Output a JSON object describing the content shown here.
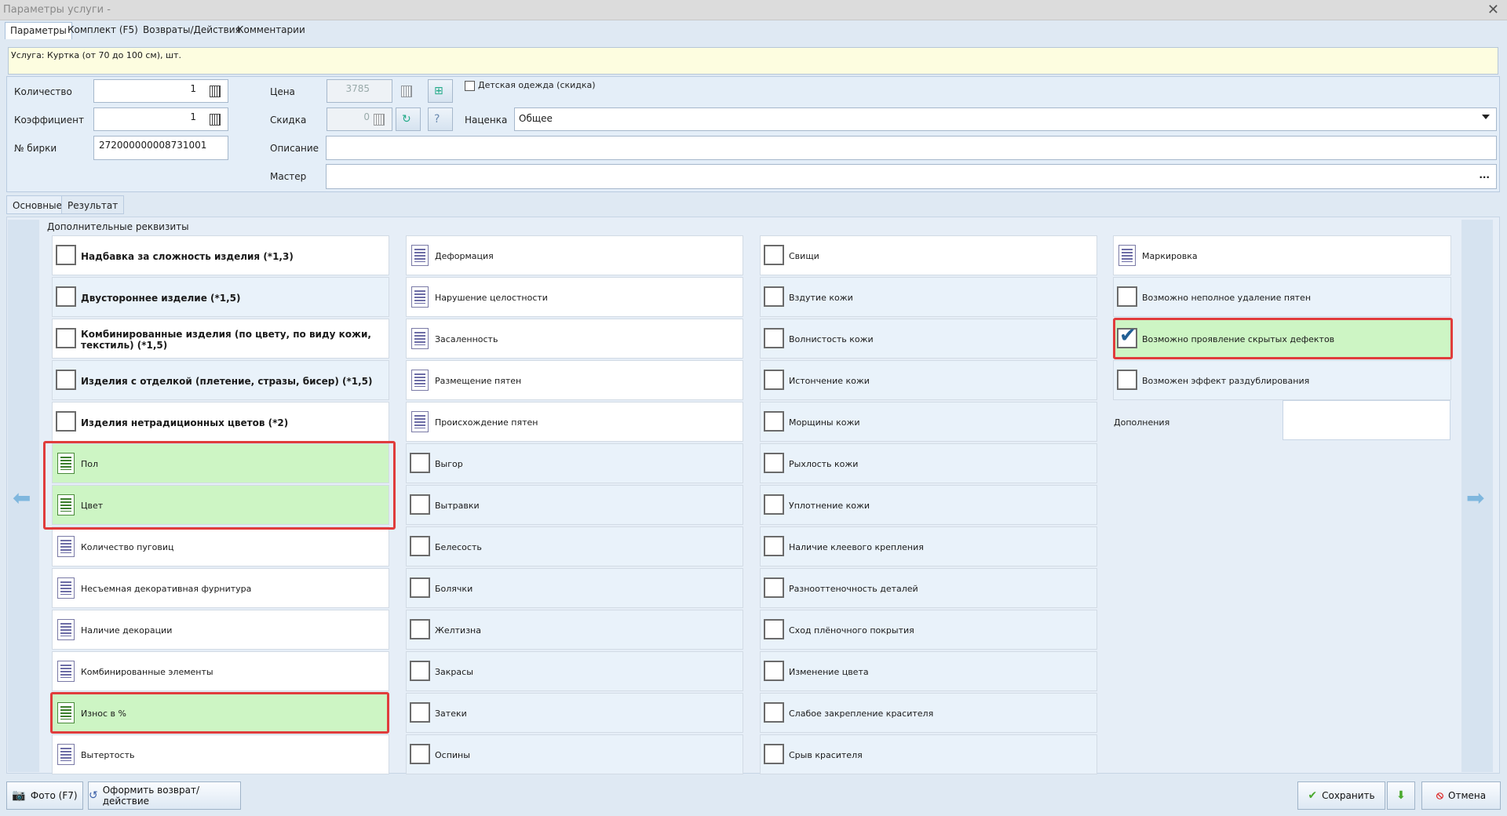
{
  "window": {
    "title": "Параметры услуги -"
  },
  "tabs_top": [
    "Параметры",
    "Комплект (F5)",
    "Возвраты/Действия",
    "Комментарии"
  ],
  "service": "Услуга: Куртка (от 70 до 100 см), шт.",
  "fields": {
    "quantity_label": "Количество",
    "quantity_value": "1",
    "coef_label": "Коэффициент",
    "coef_value": "1",
    "tag_label": "№ бирки",
    "tag_value": "272000000008731001",
    "price_label": "Цена",
    "price_value": "3785",
    "discount_label": "Скидка",
    "discount_value": "0",
    "kids_label": "Детская одежда (скидка)",
    "markup_label": "Наценка",
    "markup_value": "Общее",
    "desc_label": "Описание",
    "master_label": "Мастер",
    "master_dots": "..."
  },
  "tabs_mid": [
    "Основные",
    "Результат"
  ],
  "section_title": "Дополнительные реквизиты",
  "col1": [
    {
      "label": "Надбавка за сложность изделия (*1,3)",
      "kind": "check",
      "bold": true,
      "bg": "white"
    },
    {
      "label": "Двустороннее изделие (*1,5)",
      "kind": "check",
      "bold": true,
      "bg": "blue"
    },
    {
      "label": "Комбинированные изделия (по цвету, по виду кожи, текстиль) (*1,5)",
      "kind": "check",
      "bold": true,
      "bg": "white"
    },
    {
      "label": "Изделия с отделкой (плетение, стразы, бисер) (*1,5)",
      "kind": "check",
      "bold": true,
      "bg": "blue"
    },
    {
      "label": "Изделия нетрадиционных цветов (*2)",
      "kind": "check",
      "bold": true,
      "bg": "white"
    },
    {
      "label": "Пол",
      "kind": "list",
      "bold": false,
      "bg": "green"
    },
    {
      "label": "Цвет",
      "kind": "list",
      "bold": false,
      "bg": "green"
    },
    {
      "label": "Количество пуговиц",
      "kind": "list",
      "bold": false,
      "bg": "white"
    },
    {
      "label": "Несъемная декоративная фурнитура",
      "kind": "list",
      "bold": false,
      "bg": "white"
    },
    {
      "label": "Наличие декорации",
      "kind": "list",
      "bold": false,
      "bg": "white"
    },
    {
      "label": "Комбинированные элементы",
      "kind": "list",
      "bold": false,
      "bg": "white"
    },
    {
      "label": "Износ в %",
      "kind": "list",
      "bold": false,
      "bg": "green"
    },
    {
      "label": "Вытертость",
      "kind": "list",
      "bold": false,
      "bg": "white"
    }
  ],
  "col2": [
    {
      "label": "Деформация",
      "kind": "list",
      "bg": "white"
    },
    {
      "label": "Нарушение целостности",
      "kind": "list",
      "bg": "white"
    },
    {
      "label": "Засаленность",
      "kind": "list",
      "bg": "white"
    },
    {
      "label": "Размещение пятен",
      "kind": "list",
      "bg": "white"
    },
    {
      "label": "Происхождение пятен",
      "kind": "list",
      "bg": "white"
    },
    {
      "label": "Выгор",
      "kind": "check",
      "bg": "blue"
    },
    {
      "label": "Вытравки",
      "kind": "check",
      "bg": "blue"
    },
    {
      "label": "Белесость",
      "kind": "check",
      "bg": "blue"
    },
    {
      "label": "Болячки",
      "kind": "check",
      "bg": "blue"
    },
    {
      "label": "Желтизна",
      "kind": "check",
      "bg": "blue"
    },
    {
      "label": "Закрасы",
      "kind": "check",
      "bg": "blue"
    },
    {
      "label": "Затеки",
      "kind": "check",
      "bg": "blue"
    },
    {
      "label": "Оспины",
      "kind": "check",
      "bg": "blue"
    }
  ],
  "col3": [
    {
      "label": "Свищи",
      "kind": "check",
      "bg": "white"
    },
    {
      "label": "Вздутие кожи",
      "kind": "check",
      "bg": "blue"
    },
    {
      "label": "Волнистость кожи",
      "kind": "check",
      "bg": "blue"
    },
    {
      "label": "Истончение кожи",
      "kind": "check",
      "bg": "blue"
    },
    {
      "label": "Морщины кожи",
      "kind": "check",
      "bg": "blue"
    },
    {
      "label": "Рыхлость кожи",
      "kind": "check",
      "bg": "blue"
    },
    {
      "label": "Уплотнение кожи",
      "kind": "check",
      "bg": "blue"
    },
    {
      "label": "Наличие клеевого крепления",
      "kind": "check",
      "bg": "blue"
    },
    {
      "label": "Разнооттеночность деталей",
      "kind": "check",
      "bg": "blue"
    },
    {
      "label": "Сход плёночного покрытия",
      "kind": "check",
      "bg": "blue"
    },
    {
      "label": "Изменение цвета",
      "kind": "check",
      "bg": "blue"
    },
    {
      "label": "Слабое закрепление красителя",
      "kind": "check",
      "bg": "blue"
    },
    {
      "label": "Срыв красителя",
      "kind": "check",
      "bg": "blue"
    }
  ],
  "col4": [
    {
      "label": "Маркировка",
      "kind": "list",
      "bg": "white"
    },
    {
      "label": "Возможно неполное удаление пятен",
      "kind": "check",
      "bg": "blue"
    },
    {
      "label": "Возможно проявление скрытых дефектов",
      "kind": "check",
      "checked": true,
      "bg": "green"
    },
    {
      "label": "Возможен эффект раздублирования",
      "kind": "check",
      "bg": "blue"
    }
  ],
  "additions_label": "Дополнения",
  "buttons": {
    "photo": "Фото (F7)",
    "return": "Оформить возврат/действие",
    "save": "Сохранить",
    "cancel": "Отмена"
  },
  "colors": {
    "highlight": "#e03c3c",
    "green_row": "#cdf5c4",
    "blue_row": "#e9f2fa"
  }
}
